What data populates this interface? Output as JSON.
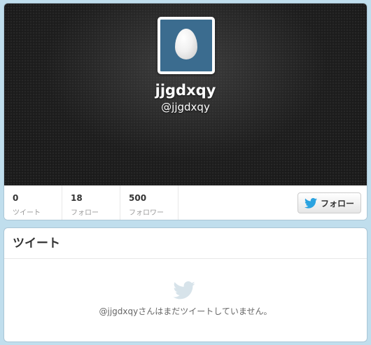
{
  "profile": {
    "name": "jjgdxqy",
    "screen_name": "@jjgdxqy",
    "avatar_icon": "egg-icon",
    "avatar_bg": "#3b6c8f"
  },
  "stats": [
    {
      "value": "0",
      "label": "ツイート"
    },
    {
      "value": "18",
      "label": "フォロー"
    },
    {
      "value": "500",
      "label": "フォロワー"
    }
  ],
  "follow_button": {
    "label": "フォロー",
    "icon": "twitter-bird-icon",
    "icon_color": "#2ba3e0"
  },
  "tweets": {
    "title": "ツイート",
    "empty_icon": "twitter-bird-icon",
    "empty_message": "@jjgdxqyさんはまだツイートしていません。"
  }
}
